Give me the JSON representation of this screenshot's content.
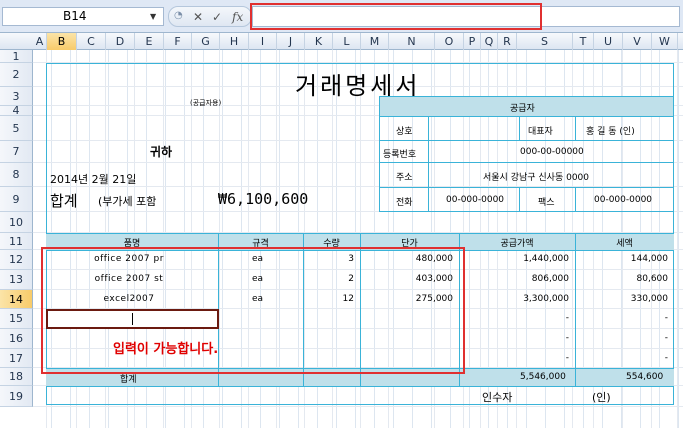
{
  "formula_bar": {
    "name_box": "B14",
    "fx_label": "fx",
    "cancel": "✕",
    "enter": "✓"
  },
  "columns": [
    "A",
    "B",
    "C",
    "D",
    "E",
    "F",
    "G",
    "H",
    "I",
    "J",
    "K",
    "L",
    "M",
    "N",
    "O",
    "P",
    "Q",
    "R",
    "S",
    "T",
    "U",
    "V",
    "W"
  ],
  "rows": [
    "1",
    "2",
    "3",
    "4",
    "5",
    "7",
    "8",
    "9",
    "10",
    "11",
    "12",
    "13",
    "14",
    "15",
    "16",
    "17",
    "18",
    "19"
  ],
  "selected_cell": "B14",
  "invoice": {
    "title": "거래명세서",
    "recipient_note": "(공급자용)",
    "to": "귀하",
    "date": "2014년 2월 21일",
    "total_label": "합계",
    "vat_note": "(부가세 포함",
    "total_amount": "₩6,100,600",
    "supplier": {
      "header": "공급자",
      "name_label": "상호",
      "name_value": "",
      "rep_label": "대표자",
      "rep_value": "홍 길 동  (인)",
      "regno_label": "등록번호",
      "regno_value": "000-00-00000",
      "addr_label": "주소",
      "addr_value": "서울시 강남구 신사동 0000",
      "tel_label": "전화",
      "tel_value": "00-000-0000",
      "fax_label": "팩스",
      "fax_value": "00-000-0000"
    },
    "table": {
      "headers": [
        "품명",
        "규격",
        "수량",
        "단가",
        "공급가액",
        "세액"
      ],
      "rows": [
        {
          "item": "office 2007 pr",
          "spec": "ea",
          "qty": "3",
          "price": "480,000",
          "supply": "1,440,000",
          "tax": "144,000"
        },
        {
          "item": "office 2007 st",
          "spec": "ea",
          "qty": "2",
          "price": "403,000",
          "supply": "806,000",
          "tax": "80,600"
        },
        {
          "item": "excel2007",
          "spec": "ea",
          "qty": "12",
          "price": "275,000",
          "supply": "3,300,000",
          "tax": "330,000"
        },
        {
          "item": "",
          "spec": "",
          "qty": "",
          "price": "",
          "supply": "-",
          "tax": "-"
        },
        {
          "item": "",
          "spec": "",
          "qty": "",
          "price": "",
          "supply": "-",
          "tax": "-"
        },
        {
          "item": "",
          "spec": "",
          "qty": "",
          "price": "",
          "supply": "-",
          "tax": "-"
        }
      ],
      "sum_label": "합계",
      "sum_supply": "5,546,000",
      "sum_tax": "554,600"
    },
    "receiver_label": "인수자",
    "receiver_seal": "(인)",
    "annotation": "입력이 가능합니다."
  }
}
